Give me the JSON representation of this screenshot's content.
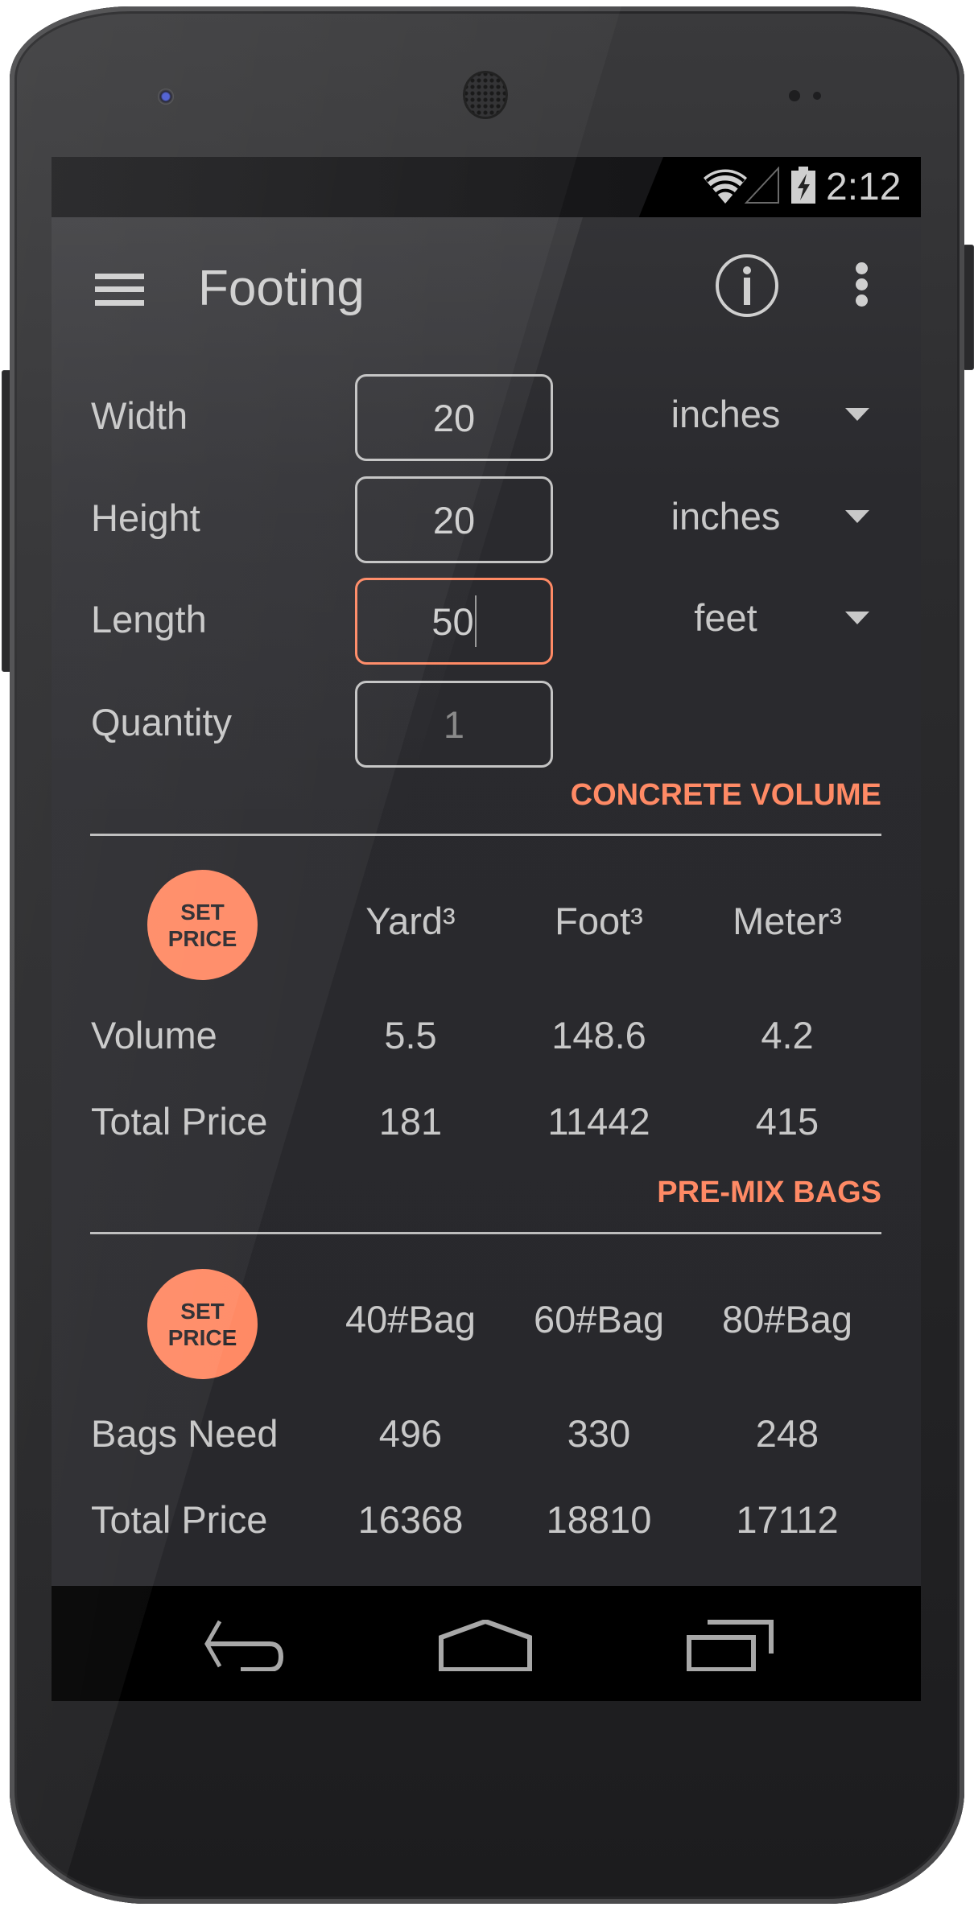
{
  "status_bar": {
    "time": "2:12",
    "icons": [
      "wifi-icon",
      "signal-icon",
      "battery-charging-icon"
    ]
  },
  "app_bar": {
    "title": "Footing",
    "menu_icon": "hamburger-icon",
    "info_icon": "info-icon",
    "overflow_icon": "overflow-menu-icon"
  },
  "inputs": [
    {
      "label": "Width",
      "value": "20",
      "unit": "inches",
      "focused": false,
      "is_hint": false
    },
    {
      "label": "Height",
      "value": "20",
      "unit": "inches",
      "focused": false,
      "is_hint": false
    },
    {
      "label": "Length",
      "value": "50",
      "unit": "feet",
      "focused": true,
      "is_hint": false
    },
    {
      "label": "Quantity",
      "value": "1",
      "unit": null,
      "focused": false,
      "is_hint": true
    }
  ],
  "concrete_volume": {
    "section_title": "CONCRETE VOLUME",
    "set_price": {
      "line1": "SET",
      "line2": "PRICE"
    },
    "columns": [
      "Yard³",
      "Foot³",
      "Meter³"
    ],
    "rows": [
      {
        "label": "Volume",
        "values": [
          "5.5",
          "148.6",
          "4.2"
        ]
      },
      {
        "label": "Total Price",
        "values": [
          "181",
          "11442",
          "415"
        ]
      }
    ]
  },
  "premix_bags": {
    "section_title": "PRE-MIX BAGS",
    "set_price": {
      "line1": "SET",
      "line2": "PRICE"
    },
    "columns": [
      "40#Bag",
      "60#Bag",
      "80#Bag"
    ],
    "rows": [
      {
        "label": "Bags Need",
        "values": [
          "496",
          "330",
          "248"
        ]
      },
      {
        "label": "Total Price",
        "values": [
          "16368",
          "18810",
          "17112"
        ]
      }
    ]
  },
  "nav_bar": {
    "buttons": [
      "back-icon",
      "home-icon",
      "recents-icon"
    ]
  },
  "colors": {
    "accent": "#FF8A65",
    "background": "#28282C",
    "text": "#C8C8C8",
    "hint_text": "#8A8A8A",
    "status_bar": "#000000"
  }
}
